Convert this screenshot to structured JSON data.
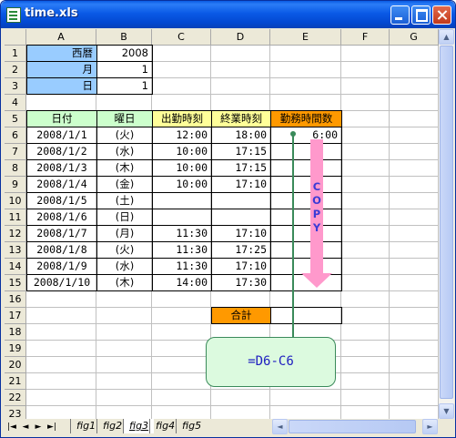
{
  "window": {
    "title": "time.xls"
  },
  "columns": [
    "A",
    "B",
    "C",
    "D",
    "E",
    "F",
    "G"
  ],
  "rows": [
    "1",
    "2",
    "3",
    "4",
    "5",
    "6",
    "7",
    "8",
    "9",
    "10",
    "11",
    "12",
    "13",
    "14",
    "15",
    "16",
    "17",
    "18",
    "19",
    "20",
    "21",
    "22",
    "23"
  ],
  "params": {
    "year_label": "西暦",
    "year_value": "2008",
    "month_label": "月",
    "month_value": "1",
    "day_label": "日",
    "day_value": "1"
  },
  "table": {
    "headers": [
      "日付",
      "曜日",
      "出勤時刻",
      "終業時刻",
      "勤務時間数"
    ],
    "rows": [
      [
        "2008/1/1",
        "(火)",
        "12:00",
        "18:00",
        "6:00"
      ],
      [
        "2008/1/2",
        "(水)",
        "10:00",
        "17:15",
        ""
      ],
      [
        "2008/1/3",
        "(木)",
        "10:00",
        "17:15",
        ""
      ],
      [
        "2008/1/4",
        "(金)",
        "10:00",
        "17:10",
        ""
      ],
      [
        "2008/1/5",
        "(土)",
        "",
        "",
        ""
      ],
      [
        "2008/1/6",
        "(日)",
        "",
        "",
        ""
      ],
      [
        "2008/1/7",
        "(月)",
        "11:30",
        "17:10",
        ""
      ],
      [
        "2008/1/8",
        "(火)",
        "11:30",
        "17:25",
        ""
      ],
      [
        "2008/1/9",
        "(水)",
        "11:30",
        "17:10",
        ""
      ],
      [
        "2008/1/10",
        "(木)",
        "14:00",
        "17:30",
        ""
      ]
    ]
  },
  "total": {
    "label": "合計",
    "value": ""
  },
  "annotations": {
    "copy_text": "COPY",
    "formula": "=D6-C6"
  },
  "sheet_tabs": [
    "fig1",
    "fig2",
    "fig3",
    "fig4",
    "fig5"
  ],
  "active_tab": "fig3",
  "colors": {
    "blue_param": "#99ccff",
    "green_header": "#ccffcc",
    "yellow_header": "#ffff99",
    "orange_header": "#ff9900",
    "copy_arrow": "#ff99cc",
    "formula_box": "#dcfadf"
  },
  "icons": [
    "excel-sheet-icon",
    "minimize-icon",
    "maximize-icon",
    "close-icon",
    "arrow-up-icon",
    "arrow-down-icon",
    "arrow-left-icon",
    "arrow-right-icon"
  ]
}
